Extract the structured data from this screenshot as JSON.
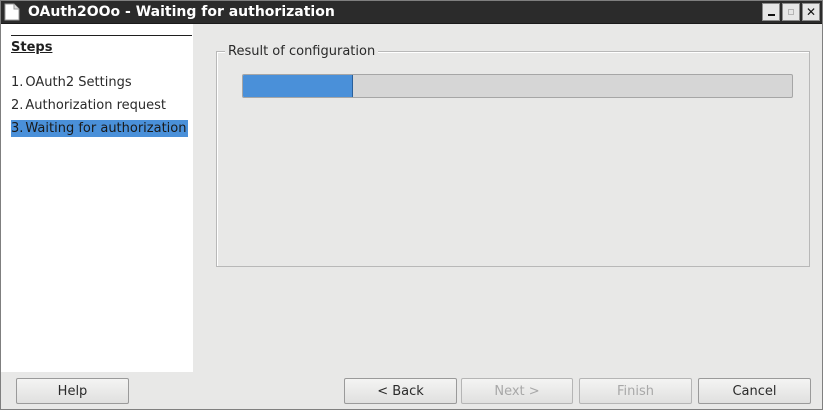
{
  "window": {
    "title": "OAuth2OOo - Waiting for authorization"
  },
  "sidebar": {
    "heading": "Steps",
    "steps": [
      {
        "number": "1.",
        "label": "OAuth2 Settings",
        "active": false
      },
      {
        "number": "2.",
        "label": "Authorization request",
        "active": false
      },
      {
        "number": "3.",
        "label": "Waiting for authorization",
        "active": true
      }
    ]
  },
  "main": {
    "group_label": "Result of configuration",
    "progress": 0.2
  },
  "buttons": {
    "help": "Help",
    "back": "< Back",
    "next": "Next >",
    "finish": "Finish",
    "cancel": "Cancel"
  },
  "colors": {
    "accent": "#4a90d9",
    "titlebar": "#2b2b2b"
  },
  "icons": {
    "app": "document-icon",
    "minimize": "minimize-icon",
    "maximize": "maximize-icon",
    "close": "close-icon"
  }
}
